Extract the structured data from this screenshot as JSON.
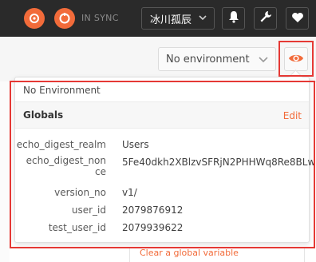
{
  "topbar": {
    "sync_label": "IN SYNC",
    "user_name": "冰川孤辰",
    "icons": [
      "sync-icon",
      "bell-icon",
      "wrench-icon",
      "heart-icon"
    ]
  },
  "environment": {
    "selected": "No environment"
  },
  "popover": {
    "no_env_label": "No Environment",
    "globals_title": "Globals",
    "edit_label": "Edit",
    "variables": [
      {
        "key": "echo_digest_realm",
        "value": "Users"
      },
      {
        "key": "echo_digest_nonce",
        "value": "5Fe40dkh2XBlzvSFRjN2PHHWq8Re8BLw"
      },
      {
        "key": "version_no",
        "value": "v1/"
      },
      {
        "key": "user_id",
        "value": "2079876912"
      },
      {
        "key": "test_user_id",
        "value": "2079939622"
      }
    ]
  },
  "background": {
    "clear_link": "Clear a global variable"
  },
  "colors": {
    "accent": "#f26b3a",
    "highlight": "#e53935",
    "topbar": "#2a2a2a"
  }
}
